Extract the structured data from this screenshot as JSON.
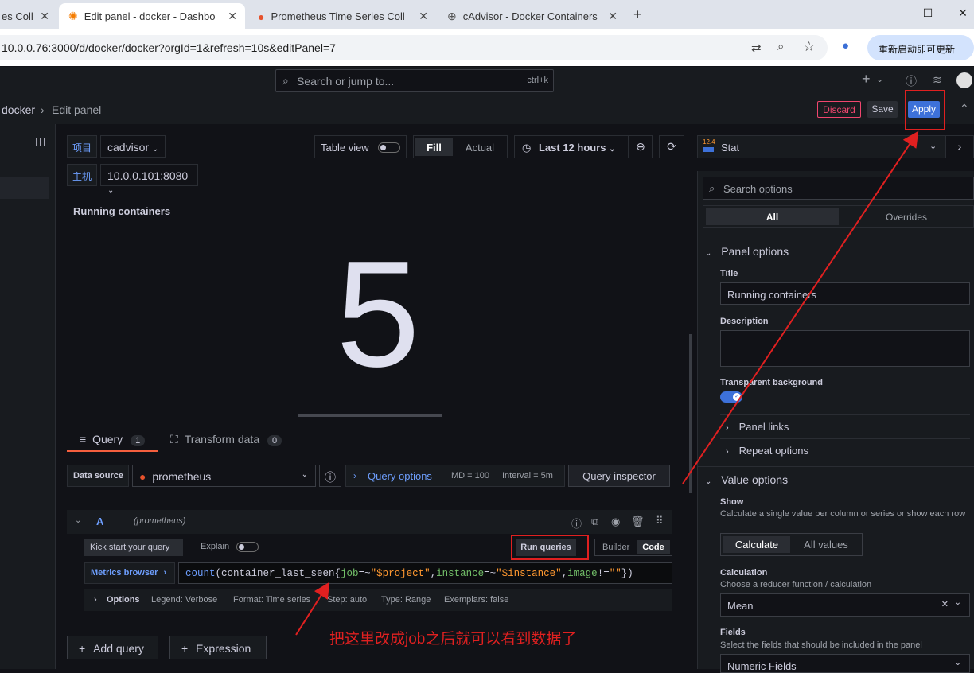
{
  "browser": {
    "tabs": [
      {
        "title": "es Coll",
        "active": false
      },
      {
        "title": "Edit panel - docker - Dashbo",
        "active": true
      },
      {
        "title": "Prometheus Time Series Coll",
        "active": false
      },
      {
        "title": "cAdvisor - Docker Containers",
        "active": false
      }
    ],
    "url": "10.0.0.76:3000/d/docker/docker?orgId=1&refresh=10s&editPanel=7",
    "update_label": "重新启动即可更新"
  },
  "topnav": {
    "search_placeholder": "Search or jump to...",
    "shortcut": "ctrl+k",
    "plus": "+"
  },
  "editbar": {
    "crumb_dashboard": "docker",
    "crumb_sep": "›",
    "crumb_edit": "Edit panel",
    "discard": "Discard",
    "save": "Save",
    "apply": "Apply"
  },
  "variables": [
    {
      "label": "项目",
      "value": "cadvisor"
    },
    {
      "label": "主机",
      "value": "10.0.0.101:8080"
    }
  ],
  "toolbar": {
    "table_view": "Table view",
    "fill": "Fill",
    "actual": "Actual",
    "time_range": "Last 12 hours"
  },
  "panel": {
    "title": "Running containers",
    "value": "5"
  },
  "query_tabs": {
    "query": "Query",
    "query_count": "1",
    "transform": "Transform data",
    "transform_count": "0"
  },
  "datasource": {
    "label": "Data source",
    "value": "prometheus",
    "query_options": "Query options",
    "md": "MD = 100",
    "interval": "Interval = 5m",
    "inspector": "Query inspector"
  },
  "query": {
    "ref": "A",
    "ds": "(prometheus)",
    "kick_start": "Kick start your query",
    "explain": "Explain",
    "run": "Run queries",
    "builder": "Builder",
    "code": "Code",
    "metrics_browser": "Metrics browser",
    "expr_fn": "count",
    "expr_open": "(container_last_seen{",
    "expr_k1": "job",
    "expr_op1": "=~",
    "expr_v1": "\"$project\"",
    "expr_c1": ",",
    "expr_k2": "instance",
    "expr_op2": "=~",
    "expr_v2": "\"$instance\"",
    "expr_c2": ",",
    "expr_k3": "image",
    "expr_op3": "!=",
    "expr_v3": "\"\"",
    "expr_close": "})",
    "options_label": "Options",
    "legend": "Legend: Verbose",
    "format": "Format: Time series",
    "step": "Step: auto",
    "type": "Type: Range",
    "exemplars": "Exemplars: false"
  },
  "buttons": {
    "add_query": "Add query",
    "expression": "Expression"
  },
  "annotation": "把这里改成job之后就可以看到数据了",
  "viz": {
    "icon_text": "12.4",
    "name": "Stat"
  },
  "options": {
    "search_placeholder": "Search options",
    "all": "All",
    "overrides": "Overrides",
    "panel_options": "Panel options",
    "title_label": "Title",
    "title_value": "Running containers",
    "description_label": "Description",
    "transparent_label": "Transparent background",
    "panel_links": "Panel links",
    "repeat_options": "Repeat options",
    "value_options": "Value options",
    "show_label": "Show",
    "show_desc": "Calculate a single value per column or series or show each row",
    "calculate": "Calculate",
    "all_values": "All values",
    "calculation_label": "Calculation",
    "calculation_desc": "Choose a reducer function / calculation",
    "calculation_value": "Mean",
    "fields_label": "Fields",
    "fields_desc": "Select the fields that should be included in the panel",
    "fields_value": "Numeric Fields"
  },
  "colors": {
    "accent": "#3d71d9",
    "annotation": "#e02020",
    "discard": "#f0466e"
  }
}
